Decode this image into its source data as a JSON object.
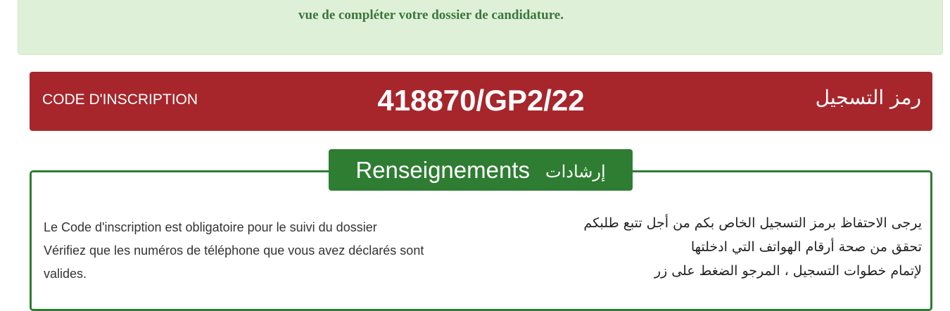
{
  "alert": {
    "text": "vue de compléter votre dossier de candidature."
  },
  "registration": {
    "label_fr": "CODE D'INSCRIPTION",
    "code": "418870/GP2/22",
    "label_ar": "رمز التسجيل"
  },
  "info_panel": {
    "title_fr": "Renseignements",
    "title_ar": "إرشادات",
    "fr_lines": [
      "Le Code d'inscription est obligatoire pour le suivi du dossier",
      "Vérifiez que les numéros de téléphone que vous avez déclarés sont valides."
    ],
    "ar_lines": [
      "يرجى الاحتفاظ برمز التسجيل الخاص بكم من أجل تتبع طلبكم",
      "تحقق من صحة أرقام الهواتف التي ادخلتها",
      "لإتمام خطوات التسجيل ، المرجو الضغط على زر"
    ]
  },
  "colors": {
    "alert_bg": "#dff0d8",
    "alert_text": "#3c763d",
    "code_bar_bg": "#a6262c",
    "panel_accent": "#2e7d32"
  }
}
